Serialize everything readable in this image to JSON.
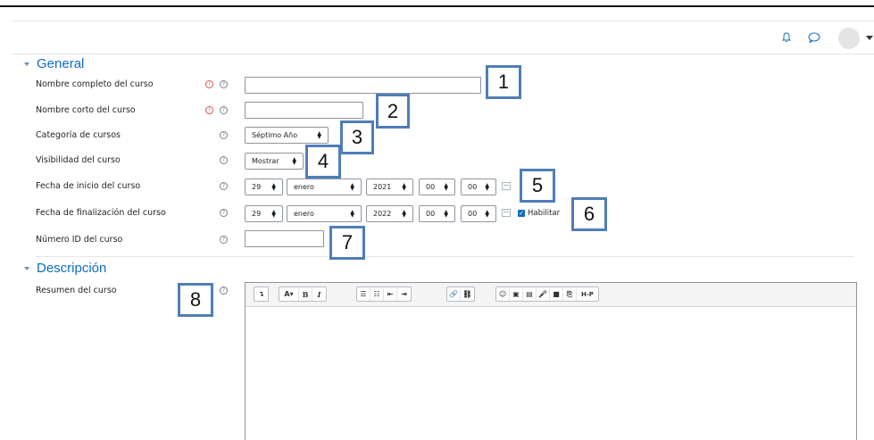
{
  "navbar": {
    "icons": [
      "bell-icon",
      "chat-icon",
      "user-avatar",
      "chevron-down-icon"
    ]
  },
  "sections": {
    "general": "General",
    "descripcion": "Descripción"
  },
  "fields": {
    "fullname": {
      "label": "Nombre completo del curso",
      "value": ""
    },
    "shortname": {
      "label": "Nombre corto del curso",
      "value": ""
    },
    "category": {
      "label": "Categoría de cursos",
      "value": "Séptimo Año"
    },
    "visibility": {
      "label": "Visibilidad del curso",
      "value": "Mostrar"
    },
    "startdate": {
      "label": "Fecha de inicio del curso",
      "day": "29",
      "month": "enero",
      "year": "2021",
      "hour": "00",
      "minute": "00"
    },
    "enddate": {
      "label": "Fecha de finalización del curso",
      "day": "29",
      "month": "enero",
      "year": "2022",
      "hour": "00",
      "minute": "00",
      "enable_label": "Habilitar",
      "enabled": true
    },
    "idnumber": {
      "label": "Número ID del curso",
      "value": ""
    },
    "summary": {
      "label": "Resumen del curso"
    }
  },
  "editor_toolbar": {
    "groups": [
      [
        "↴"
      ],
      [
        "A▾",
        "B",
        "I"
      ],
      [
        "☰",
        "☷",
        "⇤",
        "⇥"
      ],
      [
        "🔗",
        "⛓"
      ],
      [
        "☺",
        "▣",
        "▤",
        "🎤",
        "■",
        "⎘",
        "H-P"
      ]
    ]
  },
  "callouts": [
    "1",
    "2",
    "3",
    "4",
    "5",
    "6",
    "7",
    "8"
  ],
  "colors": {
    "accent": "#0f6cbf",
    "callout_border": "#4f7db8",
    "required": "#d9534f"
  }
}
